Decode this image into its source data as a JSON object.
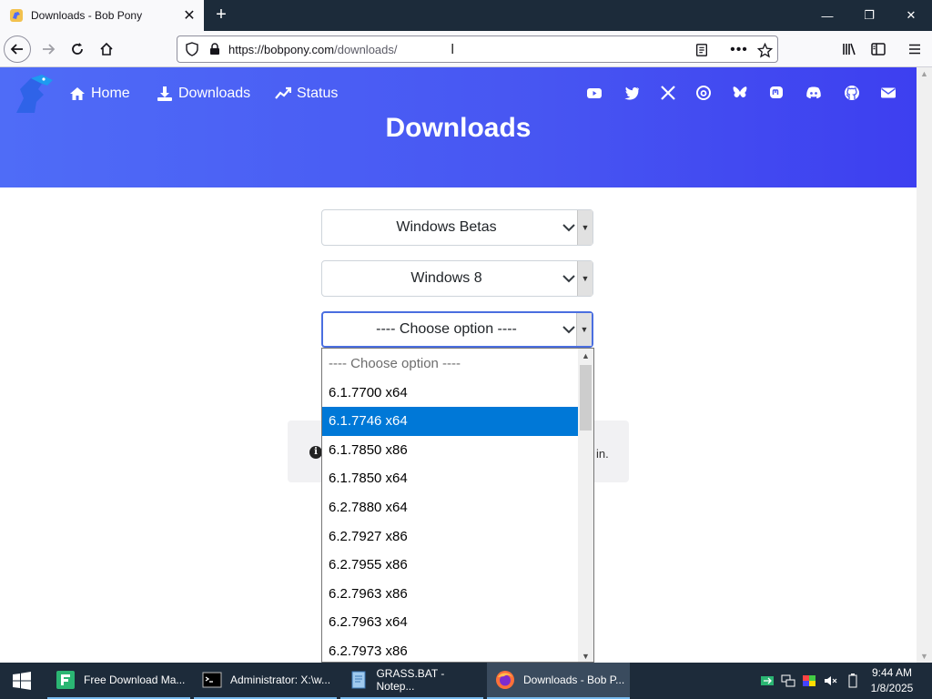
{
  "browser": {
    "tab_title": "Downloads - Bob Pony",
    "new_tab_symbol": "+",
    "url_domain": "https://bobpony.com",
    "url_path": "/downloads/"
  },
  "site": {
    "nav": [
      {
        "label": "Home",
        "icon": "home-icon"
      },
      {
        "label": "Downloads",
        "icon": "download-icon"
      },
      {
        "label": "Status",
        "icon": "trend-icon"
      }
    ],
    "social_icons": [
      "youtube-icon",
      "twitter-icon",
      "x-icon",
      "threads-icon",
      "bluesky-icon",
      "mastodon-icon",
      "discord-icon",
      "github-icon",
      "mail-icon"
    ],
    "page_title": "Downloads",
    "accent_color": "#4755f2"
  },
  "form": {
    "select1": "Windows Betas",
    "select2": "Windows 8",
    "select3": "---- Choose option ----",
    "alert_text_tail": "in."
  },
  "dropdown": {
    "options": [
      "---- Choose option ----",
      "6.1.7700 x64",
      "6.1.7746 x64",
      "6.1.7850 x86",
      "6.1.7850 x64",
      "6.2.7880 x64",
      "6.2.7927 x86",
      "6.2.7955 x86",
      "6.2.7963 x86",
      "6.2.7963 x64",
      "6.2.7973 x86"
    ],
    "highlighted_index": 2
  },
  "taskbar": {
    "tasks": [
      {
        "label": "Free Download Ma..."
      },
      {
        "label": "Administrator: X:\\w..."
      },
      {
        "label": "GRASS.BAT - Notep..."
      },
      {
        "label": "Downloads - Bob P..."
      }
    ],
    "time": "9:44 AM",
    "date": "1/8/2025"
  }
}
